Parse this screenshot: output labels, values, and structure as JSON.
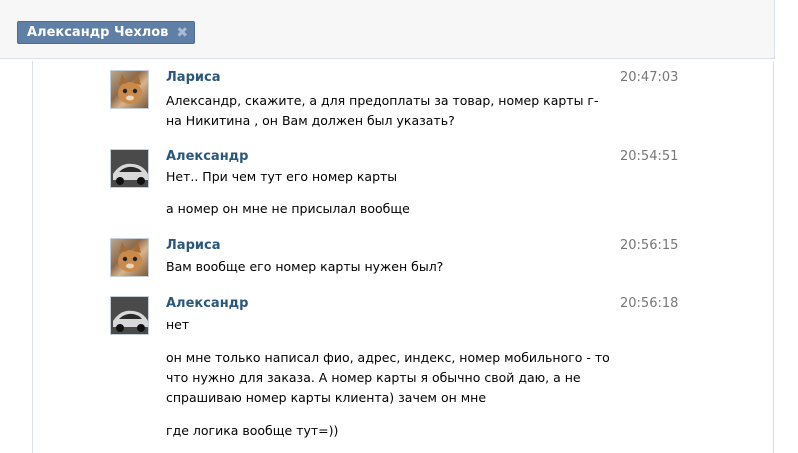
{
  "header": {
    "tab_label": "Александр Чехлов",
    "close_glyph": "✖"
  },
  "messages": [
    {
      "author": "Лариса",
      "time": "20:47:03",
      "avatar_icon": "cat-photo",
      "paragraphs": [
        "Александр, скажите, а для предоплаты за товар, номер карты г-на Никитина , он Вам должен был указать?"
      ]
    },
    {
      "author": "Александр",
      "time": "20:54:51",
      "avatar_icon": "car-photo",
      "paragraphs": [
        "Нет.. При чем тут его номер карты",
        "а номер он мне не присылал вообще"
      ]
    },
    {
      "author": "Лариса",
      "time": "20:56:15",
      "avatar_icon": "cat-photo",
      "paragraphs": [
        "Вам вообще его номер карты нужен был?"
      ]
    },
    {
      "author": "Александр",
      "time": "20:56:18",
      "avatar_icon": "car-photo",
      "paragraphs": [
        "нет",
        "он мне только написал фио, адрес, индекс, номер мобильного - то что нужно для заказа. А номер карты я обычно свой даю, а не спрашиваю номер карты клиента) зачем он мне",
        "где логика вообще тут=))"
      ]
    }
  ],
  "colors": {
    "tab_bg": "#5f7fa6",
    "author": "#2b587a",
    "time": "#777777"
  }
}
